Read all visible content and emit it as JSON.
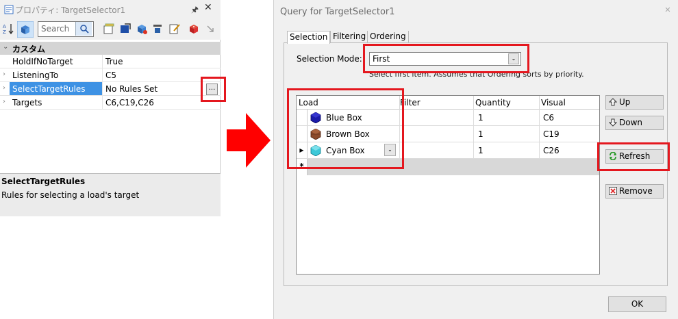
{
  "properties_panel": {
    "title": "プロパティ: TargetSelector1",
    "pin_glyph": "🖈",
    "close_glyph": "✕",
    "search_placeholder": "Search",
    "category": "カスタム",
    "rows": [
      {
        "name": "HoldIfNoTarget",
        "value": "True"
      },
      {
        "name": "ListeningTo",
        "value": "C5"
      },
      {
        "name": "SelectTargetRules",
        "value": "No Rules Set"
      },
      {
        "name": "Targets",
        "value": "C6,C19,C26"
      }
    ],
    "ellipsis_label": "...",
    "description_title": "SelectTargetRules",
    "description_text": "Rules for selecting a load's target"
  },
  "dialog": {
    "title": "Query for TargetSelector1",
    "close_glyph": "✕",
    "tabs": [
      "Selection",
      "Filtering",
      "Ordering"
    ],
    "selection_mode_label": "Selection Mode:",
    "selection_mode_value": "First",
    "selection_mode_desc": "Select first item. Assumes that Ordering sorts by priority.",
    "grid": {
      "columns": [
        "Load",
        "Filter",
        "Quantity",
        "Visual"
      ],
      "rows": [
        {
          "load": "Blue Box",
          "filter": "",
          "quantity": "1",
          "visual": "C6",
          "color": "#1b1ba8"
        },
        {
          "load": "Brown Box",
          "filter": "",
          "quantity": "1",
          "visual": "C19",
          "color": "#8b4a2b"
        },
        {
          "load": "Cyan Box",
          "filter": "",
          "quantity": "1",
          "visual": "C26",
          "color": "#3cc8d8"
        }
      ],
      "current_row_marker": "▶",
      "new_row_marker": "*"
    },
    "buttons": {
      "up": "Up",
      "down": "Down",
      "refresh": "Refresh",
      "remove": "Remove",
      "ok": "OK"
    }
  },
  "colors": {
    "highlight": "#e4171e",
    "selection": "#3e92e4"
  }
}
